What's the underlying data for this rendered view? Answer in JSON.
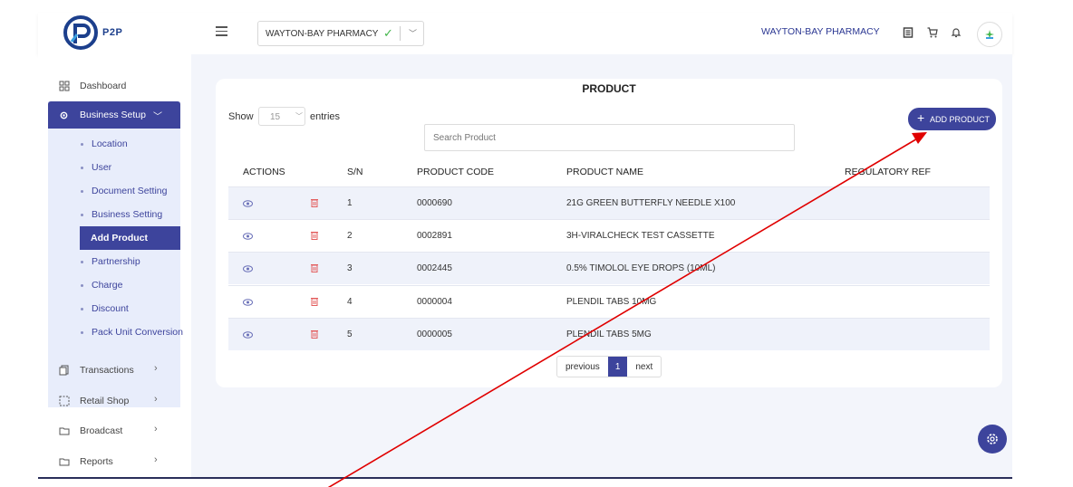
{
  "header": {
    "logo_text": "P2P",
    "store_selector_value": "WAYTON-BAY PHARMACY",
    "store_name": "WAYTON-BAY PHARMACY"
  },
  "sidebar": {
    "dashboard": "Dashboard",
    "business_setup": "Business Setup",
    "sub_items": [
      "Location",
      "User",
      "Document Setting",
      "Business Setting",
      "Add Product",
      "Partnership",
      "Charge",
      "Discount",
      "Pack Unit Conversion"
    ],
    "transactions": "Transactions",
    "retail_shop": "Retail Shop",
    "broadcast": "Broadcast",
    "reports": "Reports"
  },
  "main": {
    "title": "PRODUCT",
    "show_label": "Show",
    "entries_value": "15",
    "entries_label": "entries",
    "search_placeholder": "Search Product",
    "add_button": "ADD PRODUCT",
    "columns": [
      "ACTIONS",
      "S/N",
      "PRODUCT CODE",
      "PRODUCT NAME",
      "REGULATORY REF"
    ],
    "rows": [
      {
        "sn": "1",
        "code": "0000690",
        "name": "21G GREEN BUTTERFLY NEEDLE X100",
        "ref": ""
      },
      {
        "sn": "2",
        "code": "0002891",
        "name": "3H-VIRALCHECK TEST CASSETTE",
        "ref": ""
      },
      {
        "sn": "3",
        "code": "0002445",
        "name": "0.5% TIMOLOL EYE DROPS (10ML)",
        "ref": ""
      },
      {
        "sn": "4",
        "code": "0000004",
        "name": "PLENDIL TABS 10MG",
        "ref": ""
      },
      {
        "sn": "5",
        "code": "0000005",
        "name": "PLENDIL TABS 5MG",
        "ref": ""
      }
    ],
    "pager": {
      "previous": "previous",
      "current": "1",
      "next": "next"
    }
  },
  "colors": {
    "primary": "#3d449c",
    "accent_arrow": "#e00000",
    "check": "#42b54a",
    "delete": "#e35d5d"
  },
  "icons": [
    "dashboard-icon",
    "gear-icon",
    "transactions-icon",
    "retail-shop-icon",
    "folder-icon",
    "list-icon",
    "cart-icon",
    "bell-icon",
    "eye-icon",
    "trash-icon",
    "check-icon",
    "chevron-down-icon",
    "chevron-right-icon",
    "plus-icon"
  ]
}
